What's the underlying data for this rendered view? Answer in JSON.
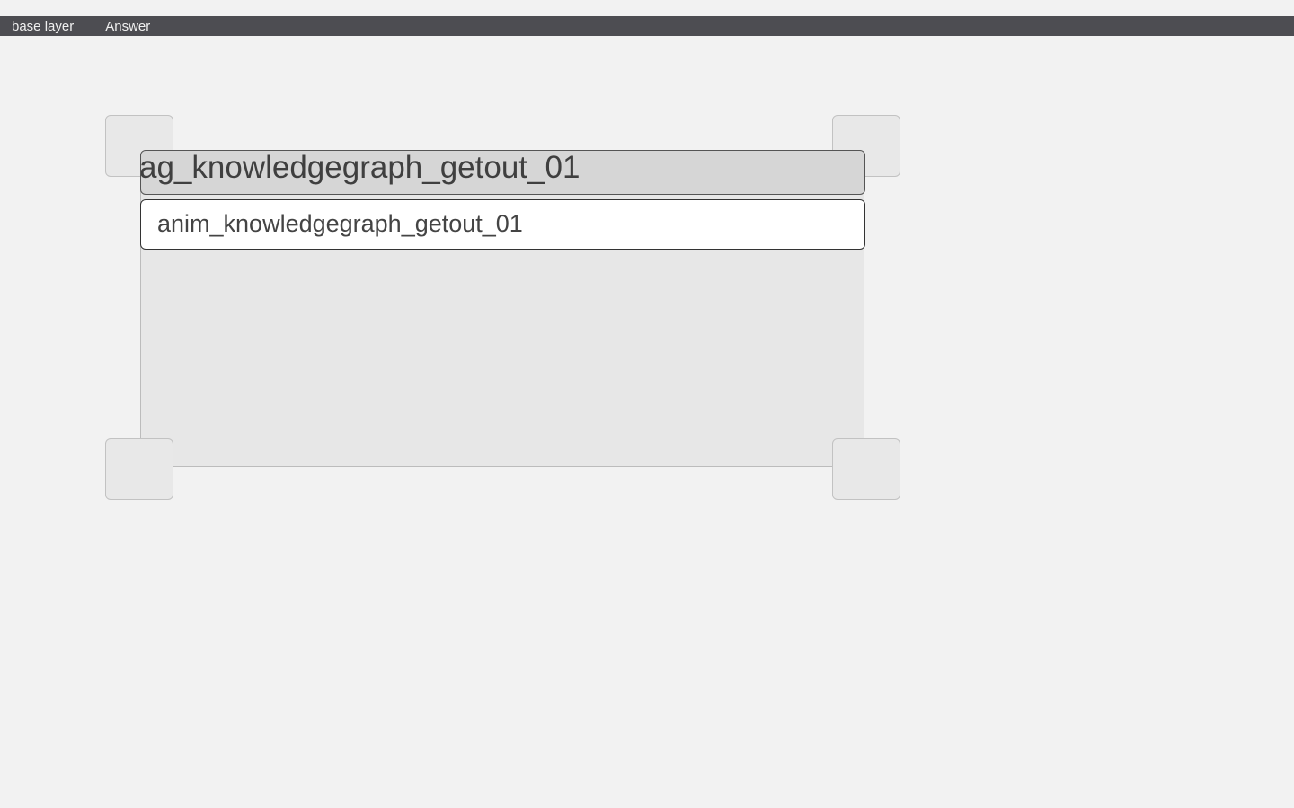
{
  "menubar": {
    "items": [
      {
        "label": "base layer"
      },
      {
        "label": "Answer"
      }
    ]
  },
  "panel": {
    "title": "ag_knowledgegraph_getout_01",
    "items": [
      {
        "label": "anim_knowledgegraph_getout_01"
      }
    ]
  }
}
